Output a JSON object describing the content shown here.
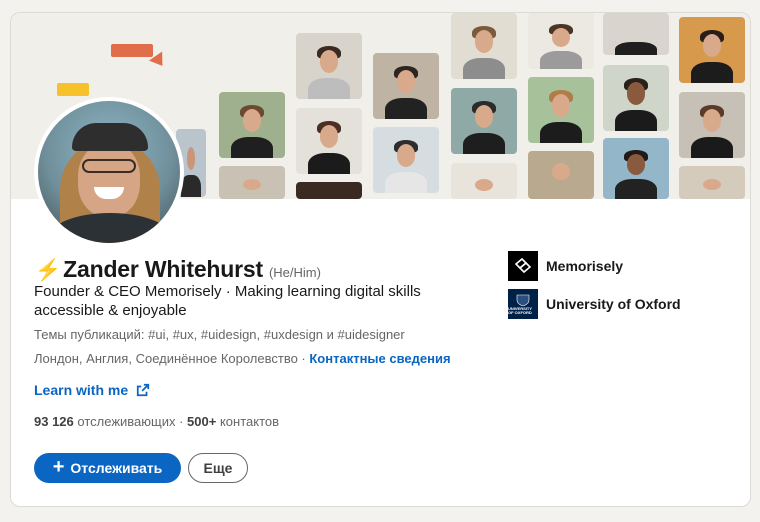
{
  "profile": {
    "bolt": "⚡",
    "name": "Zander Whitehurst",
    "pronouns": "(He/Him)",
    "headline": "Founder & CEO Memorisely · Making learning digital skills accessible & enjoyable",
    "topics": "Темы публикаций: #ui, #ux, #uidesign, #uxdesign и #uidesigner",
    "location": "Лондон, Англия, Соединённое Королевство · ",
    "contact_link": "Контактные сведения",
    "website": "Learn with me",
    "followers_count": "93 126",
    "followers_label": "отслеживающих",
    "connections_sep": " · ",
    "connections_count": "500+",
    "connections_label": "контактов"
  },
  "actions": {
    "follow_label": "Отслеживать",
    "more_label": "Еще"
  },
  "organizations": [
    {
      "name": "Memorisely",
      "logo": "memorisely-logo"
    },
    {
      "name": "University of Oxford",
      "logo": "oxford-crest-logo",
      "logo_text": "UNIVERSITY OF OXFORD"
    }
  ],
  "colors": {
    "accent": "#0a66c2",
    "bolt": "#f2b01e",
    "deco_red": "#e06e4a",
    "deco_yellow": "#f7c12c"
  }
}
